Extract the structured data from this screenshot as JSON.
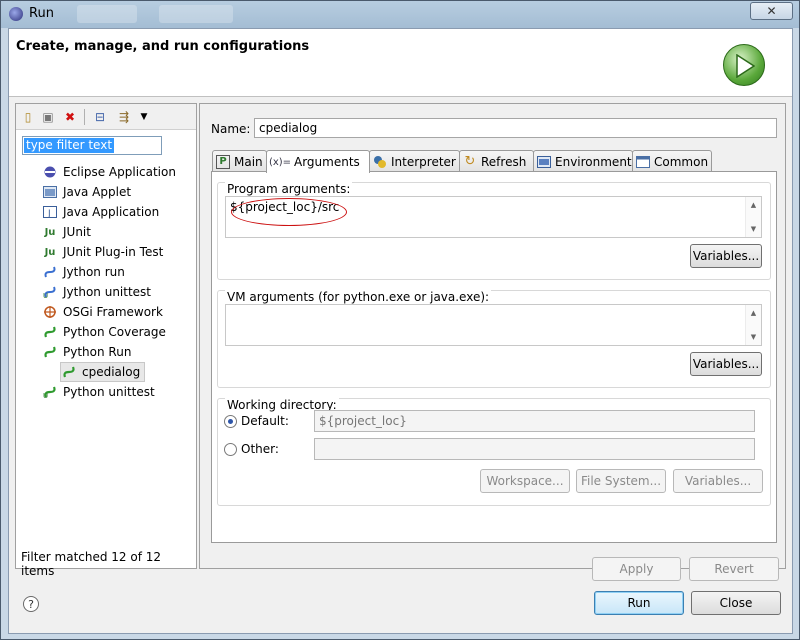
{
  "window": {
    "title": "Run"
  },
  "header": {
    "title": "Create, manage, and run configurations"
  },
  "left": {
    "filter_text": "type filter text",
    "status": "Filter matched 12 of 12 items",
    "tree": [
      {
        "label": "Eclipse Application",
        "icon": "eclipse-icon",
        "color": "#4b4fae"
      },
      {
        "label": "Java Applet",
        "icon": "applet-icon",
        "color": "#4a6fa5"
      },
      {
        "label": "Java Application",
        "icon": "java-app-icon",
        "color": "#3a5f9a"
      },
      {
        "label": "JUnit",
        "icon": "junit-icon",
        "color": "#2f7a2f"
      },
      {
        "label": "JUnit Plug-in Test",
        "icon": "junit-plugin-icon",
        "color": "#2f7a2f"
      },
      {
        "label": "Jython run",
        "icon": "jython-run-icon",
        "color": "#3a6fd0"
      },
      {
        "label": "Jython unittest",
        "icon": "jython-unittest-icon",
        "color": "#3a6fd0"
      },
      {
        "label": "OSGi Framework",
        "icon": "osgi-icon",
        "color": "#c05a20"
      },
      {
        "label": "Python Coverage",
        "icon": "python-coverage-icon",
        "color": "#2f9a2f"
      },
      {
        "label": "Python Run",
        "icon": "python-run-icon",
        "color": "#2f9a2f"
      },
      {
        "label": "cpedialog",
        "icon": "python-config-icon",
        "color": "#2f9a2f"
      },
      {
        "label": "Python unittest",
        "icon": "python-unittest-icon",
        "color": "#2f9a2f"
      }
    ]
  },
  "right": {
    "name_label": "Name:",
    "name_value": "cpedialog",
    "tabs": [
      {
        "label": "Main",
        "icon": "P"
      },
      {
        "label": "Arguments",
        "icon": "(x)="
      },
      {
        "label": "Interpreter",
        "icon": "py"
      },
      {
        "label": "Refresh",
        "icon": "↻"
      },
      {
        "label": "Environment",
        "icon": "env"
      },
      {
        "label": "Common",
        "icon": "▤"
      }
    ],
    "program_args": {
      "title": "Program arguments:",
      "value": "${project_loc}/src",
      "variables": "Variables..."
    },
    "vm_args": {
      "title": "VM arguments (for python.exe or java.exe):",
      "value": "",
      "variables": "Variables..."
    },
    "working_dir": {
      "title": "Working directory:",
      "default_label": "Default:",
      "default_value": "${project_loc}",
      "other_label": "Other:",
      "other_value": "",
      "workspace": "Workspace...",
      "file_system": "File System...",
      "variables": "Variables..."
    },
    "apply": "Apply",
    "revert": "Revert"
  },
  "footer": {
    "run": "Run",
    "close": "Close",
    "help": "?"
  }
}
